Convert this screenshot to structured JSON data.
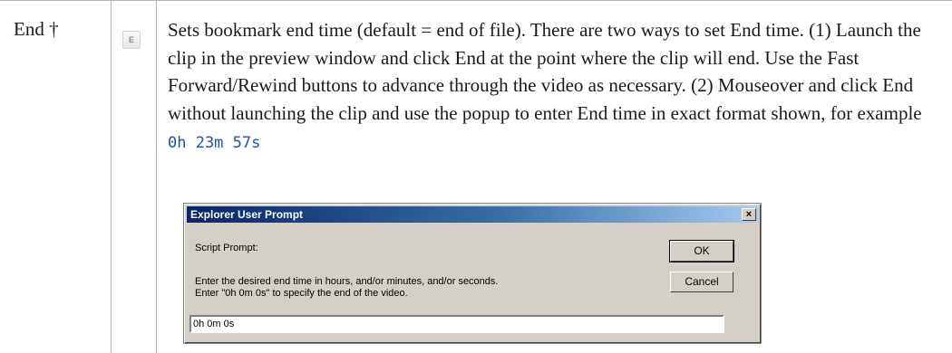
{
  "table_row": {
    "term": "End †",
    "icon_letter": "E",
    "description_prefix": "Sets bookmark end time (default = end of file). There are two ways to set End time. (1) Launch the clip in the preview window and click End at the point where the clip will end. Use the Fast Forward/Rewind buttons to advance through the video as necessary. (2) Mouseover and click End without launching the clip and use the popup to enter End time in exact format shown, for example ",
    "example_code": "0h 23m 57s"
  },
  "dialog": {
    "title": "Explorer User Prompt",
    "close_glyph": "×",
    "script_prompt_label": "Script Prompt:",
    "instruction_line1": "Enter the desired end time in hours, and/or minutes, and/or seconds.",
    "instruction_line2": "Enter \"0h 0m 0s\" to specify the end of the video.",
    "ok_label": "OK",
    "cancel_label": "Cancel",
    "input_value": "0h 0m 0s"
  }
}
